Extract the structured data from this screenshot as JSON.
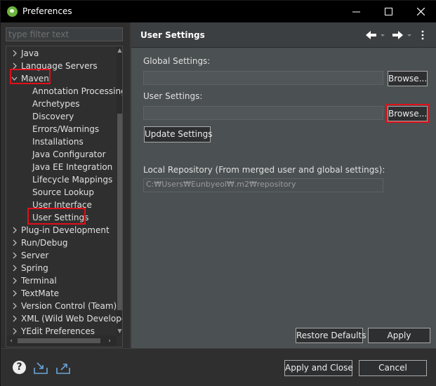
{
  "window": {
    "title": "Preferences"
  },
  "filter": {
    "placeholder": "type filter text"
  },
  "tree": {
    "items": [
      {
        "label": "Java",
        "level": 0,
        "expanded": false
      },
      {
        "label": "Language Servers",
        "level": 0,
        "expanded": false
      },
      {
        "label": "Maven",
        "level": 0,
        "expanded": true
      },
      {
        "label": "Annotation Processing",
        "level": 1
      },
      {
        "label": "Archetypes",
        "level": 1
      },
      {
        "label": "Discovery",
        "level": 1
      },
      {
        "label": "Errors/Warnings",
        "level": 1
      },
      {
        "label": "Installations",
        "level": 1
      },
      {
        "label": "Java Configurator",
        "level": 1
      },
      {
        "label": "Java EE Integration",
        "level": 1
      },
      {
        "label": "Lifecycle Mappings",
        "level": 1
      },
      {
        "label": "Source Lookup",
        "level": 1
      },
      {
        "label": "User Interface",
        "level": 1
      },
      {
        "label": "User Settings",
        "level": 1,
        "selected": true
      },
      {
        "label": "Plug-in Development",
        "level": 0,
        "expanded": false
      },
      {
        "label": "Run/Debug",
        "level": 0,
        "expanded": false
      },
      {
        "label": "Server",
        "level": 0,
        "expanded": false
      },
      {
        "label": "Spring",
        "level": 0,
        "expanded": false
      },
      {
        "label": "Terminal",
        "level": 0,
        "expanded": false
      },
      {
        "label": "TextMate",
        "level": 0,
        "expanded": false
      },
      {
        "label": "Version Control (Team)",
        "level": 0,
        "expanded": false
      },
      {
        "label": "XML (Wild Web Developer)",
        "level": 0,
        "expanded": false
      },
      {
        "label": "YEdit Preferences",
        "level": 0,
        "expanded": false
      }
    ]
  },
  "page": {
    "title": "User Settings",
    "global_settings_label": "Global Settings:",
    "global_settings_value": "",
    "global_browse": "Browse...",
    "user_settings_label": "User Settings:",
    "user_settings_value": "",
    "user_browse": "Browse...",
    "update_settings": "Update Settings",
    "local_repo_label": "Local Repository (From merged user and global settings):",
    "local_repo_value": "C:₩Users₩Eunbyeol₩.m2₩repository",
    "restore_defaults": "Restore Defaults",
    "apply": "Apply"
  },
  "footer": {
    "apply_and_close": "Apply and Close",
    "cancel": "Cancel"
  },
  "icons": {
    "app": "spring-leaf-icon",
    "help": "help-icon",
    "import": "import-icon",
    "export": "export-icon",
    "back": "back-arrow-icon",
    "forward": "forward-arrow-icon",
    "menu": "more-vertical-icon"
  },
  "colors": {
    "highlight": "#e0101a",
    "page_bg": "#4b5052",
    "app_icon": "#6db33f"
  }
}
